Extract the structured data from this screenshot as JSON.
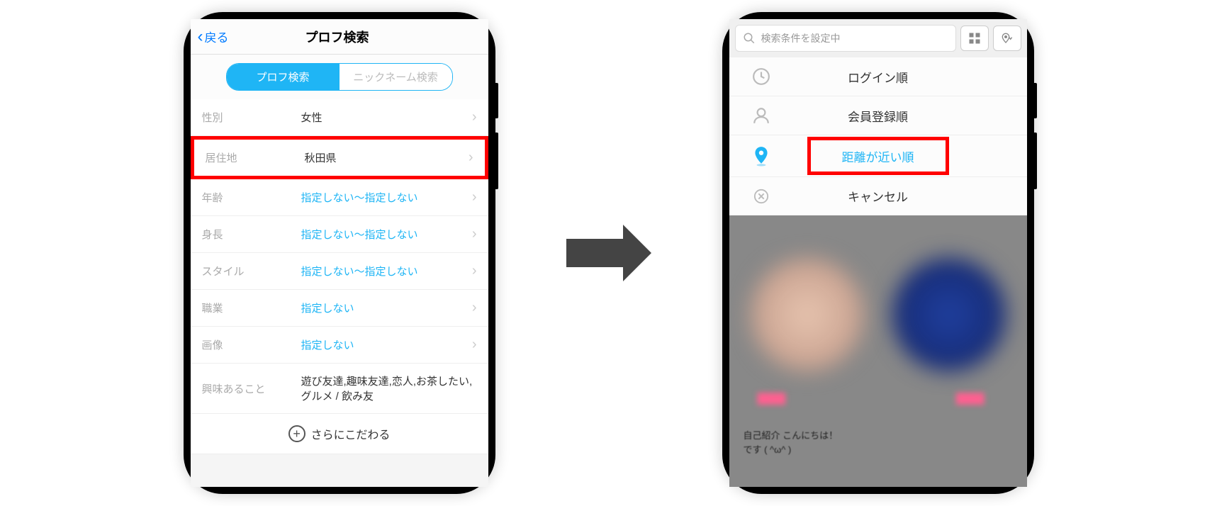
{
  "left_phone": {
    "nav": {
      "back_label": "戻る",
      "title": "プロフ検索"
    },
    "segments": {
      "profile": "プロフ検索",
      "nickname": "ニックネーム検索"
    },
    "rows": [
      {
        "label": "性別",
        "value": "女性",
        "link": false
      },
      {
        "label": "居住地",
        "value": "秋田県",
        "link": false,
        "highlight": true
      },
      {
        "label": "年齢",
        "value": "指定しない～指定しない",
        "link": true
      },
      {
        "label": "身長",
        "value": "指定しない～指定しない",
        "link": true
      },
      {
        "label": "スタイル",
        "value": "指定しない～指定しない",
        "link": true
      },
      {
        "label": "職業",
        "value": "指定しない",
        "link": true
      },
      {
        "label": "画像",
        "value": "指定しない",
        "link": true
      },
      {
        "label": "興味あること",
        "value": "遊び友達,趣味友達,恋人,お茶したい,グルメ / 飲み友",
        "link": false
      }
    ],
    "more_label": "さらにこだわる"
  },
  "right_phone": {
    "search_placeholder": "検索条件を設定中",
    "sort_options": {
      "login": "ログイン順",
      "register": "会員登録順",
      "distance": "距離が近い順",
      "cancel": "キャンセル"
    },
    "profile_text_1": "自己紹介 こんにちは！",
    "profile_text_2": "です ( ^ω^ )"
  }
}
